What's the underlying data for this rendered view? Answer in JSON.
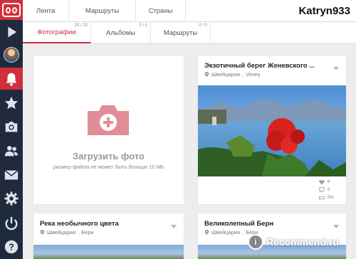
{
  "sidebar": {
    "items": [
      {
        "icon": "logo-icon"
      },
      {
        "icon": "play-icon"
      },
      {
        "icon": "avatar"
      },
      {
        "icon": "bell-icon",
        "active": true
      },
      {
        "icon": "star-icon"
      },
      {
        "icon": "camera-icon"
      },
      {
        "icon": "users-icon"
      },
      {
        "icon": "mail-icon"
      },
      {
        "icon": "gear-icon"
      },
      {
        "icon": "power-icon"
      },
      {
        "icon": "help-icon"
      }
    ],
    "accent": "#d0303b",
    "bg": "#1f2a3d"
  },
  "header": {
    "tabs": [
      {
        "label": "Лента"
      },
      {
        "label": "Маршруты"
      },
      {
        "label": "Страны"
      }
    ],
    "username": "Katryn933"
  },
  "subtabs": [
    {
      "label": "Фотографии",
      "count": "20 / 20",
      "active": true
    },
    {
      "label": "Альбомы",
      "count": "0 / 0"
    },
    {
      "label": "Маршруты",
      "count": "0 / 0"
    }
  ],
  "upload": {
    "title": "Загрузить фото",
    "subtitle": "размер файла не может быть больше 10 Mb"
  },
  "cards": [
    {
      "title": "Экзотичный берег Женевского ...",
      "country": "Швейцария",
      "city": "Vevey",
      "likes": "6",
      "comments": "0",
      "percent": "0%"
    },
    {
      "title": "Река необычного цвета",
      "country": "Швейцария",
      "city": "Берн"
    },
    {
      "title": "Великолепный Берн",
      "country": "Швейцария",
      "city": "Берн"
    }
  ],
  "watermark": {
    "text": "Recommend.ru"
  }
}
